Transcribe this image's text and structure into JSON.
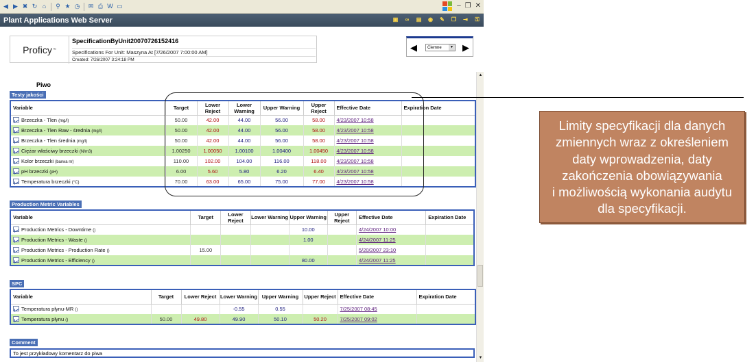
{
  "window": {
    "app_title": "Plant Applications Web Server",
    "controls": [
      "–",
      "❐",
      "✕"
    ]
  },
  "report": {
    "logo": "Proficy",
    "logo_tm": "™",
    "title": "SpecificationByUnit20070726152416",
    "subtitle": "Specifications For Unit: Maszyna At [7/26/2007 7:00:00 AM]",
    "created": "Created: 7/26/2007 3:24:18 PM",
    "nav_select_value": "Ciemne",
    "product": "Piwo"
  },
  "sections": {
    "quality": {
      "tab": "Testy jakości",
      "headers": [
        "Variable",
        "Target",
        "Lower Reject",
        "Lower Warning",
        "Upper Warning",
        "Upper Reject",
        "Effective Date",
        "Expiration Date"
      ],
      "rows": [
        {
          "name": "Brzeczka - Tlen",
          "unit": "(mg/l)",
          "target": "50.00",
          "lr": "42.00",
          "lw": "44.00",
          "uw": "56.00",
          "ur": "58.00",
          "eff": "4/23/2007 10:58",
          "exp": ""
        },
        {
          "name": "Brzeczka - Tlen Raw - średnia",
          "unit": "(mg/l)",
          "target": "50.00",
          "lr": "42.00",
          "lw": "44.00",
          "uw": "56.00",
          "ur": "58.00",
          "eff": "4/23/2007 10:58",
          "exp": ""
        },
        {
          "name": "Brzeczka - Tlen średnia",
          "unit": "(mg/l)",
          "target": "50.00",
          "lr": "42.00",
          "lw": "44.00",
          "uw": "56.00",
          "ur": "58.00",
          "eff": "4/23/2007 10:58",
          "exp": ""
        },
        {
          "name": "Ciężar właściwy brzeczki",
          "unit": "(N/m3)",
          "target": "1.00250",
          "lr": "1.00050",
          "lw": "1.00100",
          "uw": "1.00400",
          "ur": "1.00450",
          "eff": "4/23/2007 10:58",
          "exp": ""
        },
        {
          "name": "Kolor brzeczki",
          "unit": "(barwa nr)",
          "target": "110.00",
          "lr": "102.00",
          "lw": "104.00",
          "uw": "116.00",
          "ur": "118.00",
          "eff": "4/23/2007 10:58",
          "exp": ""
        },
        {
          "name": "pH brzeczki",
          "unit": "(pH)",
          "target": "6.00",
          "lr": "5.60",
          "lw": "5.80",
          "uw": "6.20",
          "ur": "6.40",
          "eff": "4/23/2007 10:58",
          "exp": ""
        },
        {
          "name": "Temperatura brzeczki",
          "unit": "(°C)",
          "target": "70.00",
          "lr": "63.00",
          "lw": "65.00",
          "uw": "75.00",
          "ur": "77.00",
          "eff": "4/23/2007 10:58",
          "exp": ""
        }
      ]
    },
    "production": {
      "tab": "Production Metric Variables",
      "headers": [
        "Variable",
        "Target",
        "Lower Reject",
        "Lower Warning",
        "Upper Warning",
        "Upper Reject",
        "Effective Date",
        "Expiration Date"
      ],
      "rows": [
        {
          "name": "Production Metrics - Downtime",
          "unit": "()",
          "target": "",
          "lr": "",
          "lw": "",
          "uw": "10.00",
          "ur": "",
          "eff": "4/24/2007 10:00",
          "exp": ""
        },
        {
          "name": "Production Metrics - Waste",
          "unit": "()",
          "target": "",
          "lr": "",
          "lw": "",
          "uw": "1.00",
          "ur": "",
          "eff": "4/24/2007 11:25",
          "exp": ""
        },
        {
          "name": "Production Metrics - Production Rate",
          "unit": "()",
          "target": "15.00",
          "lr": "",
          "lw": "",
          "uw": "",
          "ur": "",
          "eff": "5/20/2007 23:10",
          "exp": ""
        },
        {
          "name": "Production Metrics - Efficiency",
          "unit": "()",
          "target": "",
          "lr": "",
          "lw": "",
          "uw": "80.00",
          "ur": "",
          "eff": "4/24/2007 11:25",
          "exp": ""
        }
      ]
    },
    "spc": {
      "tab": "SPC",
      "headers": [
        "Variable",
        "Target",
        "Lower Reject",
        "Lower Warning",
        "Upper Warning",
        "Upper Reject",
        "Effective Date",
        "Expiration Date"
      ],
      "rows": [
        {
          "name": "Temperatura płynu-MR",
          "unit": "()",
          "target": "",
          "lr": "",
          "lw": "-0.55",
          "uw": "0.55",
          "ur": "",
          "eff": "7/25/2007 08:45",
          "exp": ""
        },
        {
          "name": "Temperatura płynu",
          "unit": "()",
          "target": "50.00",
          "lr": "49.80",
          "lw": "49.90",
          "uw": "50.10",
          "ur": "50.20",
          "eff": "7/25/2007 09:02",
          "exp": ""
        }
      ]
    },
    "comment": {
      "tab": "Comment",
      "text": "To jest przykładowy komentarz do piwa"
    }
  },
  "callout": {
    "lines": [
      "Limity specyfikacji dla danych",
      "zmiennych wraz z określeniem",
      "daty wprowadzenia, daty",
      "zakończenia obowiązywania",
      "i możliwością wykonania audytu",
      "dla specyfikacji."
    ]
  }
}
